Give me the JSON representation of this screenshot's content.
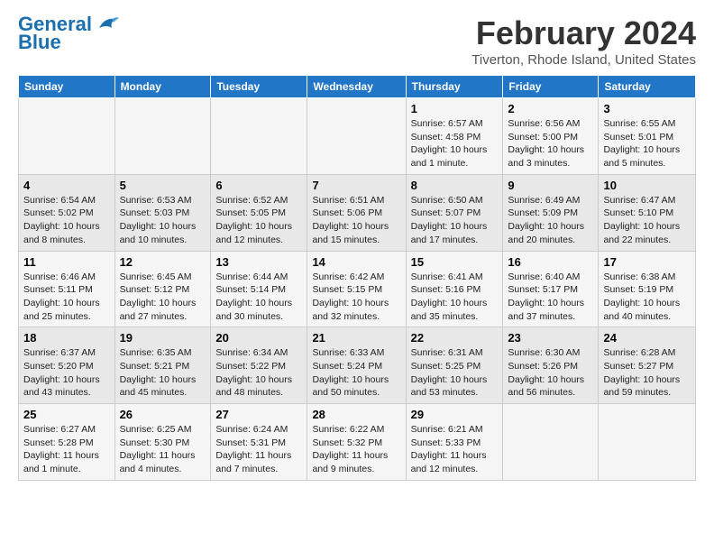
{
  "header": {
    "logo_general": "General",
    "logo_blue": "Blue",
    "main_title": "February 2024",
    "subtitle": "Tiverton, Rhode Island, United States"
  },
  "columns": [
    "Sunday",
    "Monday",
    "Tuesday",
    "Wednesday",
    "Thursday",
    "Friday",
    "Saturday"
  ],
  "weeks": [
    [
      {
        "day": "",
        "info": ""
      },
      {
        "day": "",
        "info": ""
      },
      {
        "day": "",
        "info": ""
      },
      {
        "day": "",
        "info": ""
      },
      {
        "day": "1",
        "info": "Sunrise: 6:57 AM\nSunset: 4:58 PM\nDaylight: 10 hours and 1 minute."
      },
      {
        "day": "2",
        "info": "Sunrise: 6:56 AM\nSunset: 5:00 PM\nDaylight: 10 hours and 3 minutes."
      },
      {
        "day": "3",
        "info": "Sunrise: 6:55 AM\nSunset: 5:01 PM\nDaylight: 10 hours and 5 minutes."
      }
    ],
    [
      {
        "day": "4",
        "info": "Sunrise: 6:54 AM\nSunset: 5:02 PM\nDaylight: 10 hours and 8 minutes."
      },
      {
        "day": "5",
        "info": "Sunrise: 6:53 AM\nSunset: 5:03 PM\nDaylight: 10 hours and 10 minutes."
      },
      {
        "day": "6",
        "info": "Sunrise: 6:52 AM\nSunset: 5:05 PM\nDaylight: 10 hours and 12 minutes."
      },
      {
        "day": "7",
        "info": "Sunrise: 6:51 AM\nSunset: 5:06 PM\nDaylight: 10 hours and 15 minutes."
      },
      {
        "day": "8",
        "info": "Sunrise: 6:50 AM\nSunset: 5:07 PM\nDaylight: 10 hours and 17 minutes."
      },
      {
        "day": "9",
        "info": "Sunrise: 6:49 AM\nSunset: 5:09 PM\nDaylight: 10 hours and 20 minutes."
      },
      {
        "day": "10",
        "info": "Sunrise: 6:47 AM\nSunset: 5:10 PM\nDaylight: 10 hours and 22 minutes."
      }
    ],
    [
      {
        "day": "11",
        "info": "Sunrise: 6:46 AM\nSunset: 5:11 PM\nDaylight: 10 hours and 25 minutes."
      },
      {
        "day": "12",
        "info": "Sunrise: 6:45 AM\nSunset: 5:12 PM\nDaylight: 10 hours and 27 minutes."
      },
      {
        "day": "13",
        "info": "Sunrise: 6:44 AM\nSunset: 5:14 PM\nDaylight: 10 hours and 30 minutes."
      },
      {
        "day": "14",
        "info": "Sunrise: 6:42 AM\nSunset: 5:15 PM\nDaylight: 10 hours and 32 minutes."
      },
      {
        "day": "15",
        "info": "Sunrise: 6:41 AM\nSunset: 5:16 PM\nDaylight: 10 hours and 35 minutes."
      },
      {
        "day": "16",
        "info": "Sunrise: 6:40 AM\nSunset: 5:17 PM\nDaylight: 10 hours and 37 minutes."
      },
      {
        "day": "17",
        "info": "Sunrise: 6:38 AM\nSunset: 5:19 PM\nDaylight: 10 hours and 40 minutes."
      }
    ],
    [
      {
        "day": "18",
        "info": "Sunrise: 6:37 AM\nSunset: 5:20 PM\nDaylight: 10 hours and 43 minutes."
      },
      {
        "day": "19",
        "info": "Sunrise: 6:35 AM\nSunset: 5:21 PM\nDaylight: 10 hours and 45 minutes."
      },
      {
        "day": "20",
        "info": "Sunrise: 6:34 AM\nSunset: 5:22 PM\nDaylight: 10 hours and 48 minutes."
      },
      {
        "day": "21",
        "info": "Sunrise: 6:33 AM\nSunset: 5:24 PM\nDaylight: 10 hours and 50 minutes."
      },
      {
        "day": "22",
        "info": "Sunrise: 6:31 AM\nSunset: 5:25 PM\nDaylight: 10 hours and 53 minutes."
      },
      {
        "day": "23",
        "info": "Sunrise: 6:30 AM\nSunset: 5:26 PM\nDaylight: 10 hours and 56 minutes."
      },
      {
        "day": "24",
        "info": "Sunrise: 6:28 AM\nSunset: 5:27 PM\nDaylight: 10 hours and 59 minutes."
      }
    ],
    [
      {
        "day": "25",
        "info": "Sunrise: 6:27 AM\nSunset: 5:28 PM\nDaylight: 11 hours and 1 minute."
      },
      {
        "day": "26",
        "info": "Sunrise: 6:25 AM\nSunset: 5:30 PM\nDaylight: 11 hours and 4 minutes."
      },
      {
        "day": "27",
        "info": "Sunrise: 6:24 AM\nSunset: 5:31 PM\nDaylight: 11 hours and 7 minutes."
      },
      {
        "day": "28",
        "info": "Sunrise: 6:22 AM\nSunset: 5:32 PM\nDaylight: 11 hours and 9 minutes."
      },
      {
        "day": "29",
        "info": "Sunrise: 6:21 AM\nSunset: 5:33 PM\nDaylight: 11 hours and 12 minutes."
      },
      {
        "day": "",
        "info": ""
      },
      {
        "day": "",
        "info": ""
      }
    ]
  ]
}
